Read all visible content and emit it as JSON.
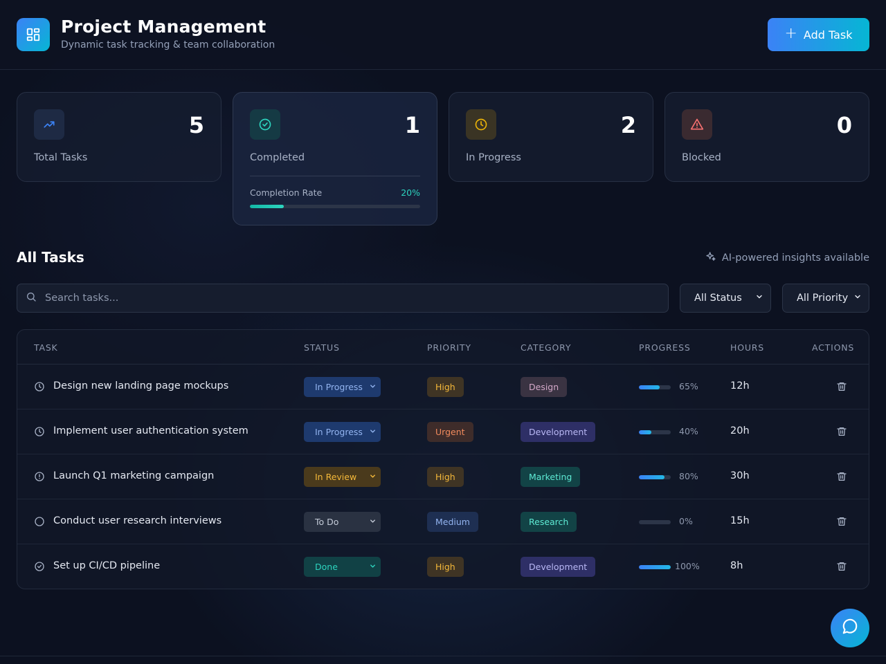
{
  "header": {
    "title": "Project Management",
    "subtitle": "Dynamic task tracking & team collaboration",
    "add_button_label": "Add Task",
    "add_button_icon": "plus-icon"
  },
  "stats": [
    {
      "label": "Total Tasks",
      "value": "5",
      "icon": "trending-up-icon",
      "color": "#3b82f6"
    },
    {
      "label": "Completed",
      "value": "1",
      "icon": "check-circle-icon",
      "color": "#2dd4bf"
    },
    {
      "label": "In Progress",
      "value": "2",
      "icon": "clock-icon",
      "color": "#eab308"
    },
    {
      "label": "Blocked",
      "value": "0",
      "icon": "alert-triangle-icon",
      "color": "#f87171"
    }
  ],
  "completion": {
    "label": "Completion Rate",
    "value_text": "20%",
    "fraction": 0.2
  },
  "section": {
    "title": "All Tasks",
    "ai_note": "AI-powered insights available"
  },
  "filters": {
    "search_placeholder": "Search tasks...",
    "status_selected": "All Status",
    "priority_selected": "All Priority"
  },
  "table": {
    "columns": [
      "TASK",
      "STATUS",
      "PRIORITY",
      "CATEGORY",
      "PROGRESS",
      "HOURS",
      "ACTIONS"
    ],
    "rows": [
      {
        "task": "Design new landing page mockups",
        "icon": "clock-icon",
        "status": "In Progress",
        "priority": "High",
        "category": "Design",
        "progress": 65,
        "progress_text": "65%",
        "hours": "12h"
      },
      {
        "task": "Implement user authentication system",
        "icon": "clock-icon",
        "status": "In Progress",
        "priority": "Urgent",
        "category": "Development",
        "progress": 40,
        "progress_text": "40%",
        "hours": "20h"
      },
      {
        "task": "Launch Q1 marketing campaign",
        "icon": "alert-circle-icon",
        "status": "In Review",
        "priority": "High",
        "category": "Marketing",
        "progress": 80,
        "progress_text": "80%",
        "hours": "30h"
      },
      {
        "task": "Conduct user research interviews",
        "icon": "circle-icon",
        "status": "To Do",
        "priority": "Medium",
        "category": "Research",
        "progress": 0,
        "progress_text": "0%",
        "hours": "15h"
      },
      {
        "task": "Set up CI/CD pipeline",
        "icon": "check-circle-icon",
        "status": "Done",
        "priority": "High",
        "category": "Development",
        "progress": 100,
        "progress_text": "100%",
        "hours": "8h"
      }
    ]
  },
  "colors": {
    "accent": "#3b82f6",
    "accent_2": "#06b6d4",
    "background": "#0c1120"
  }
}
